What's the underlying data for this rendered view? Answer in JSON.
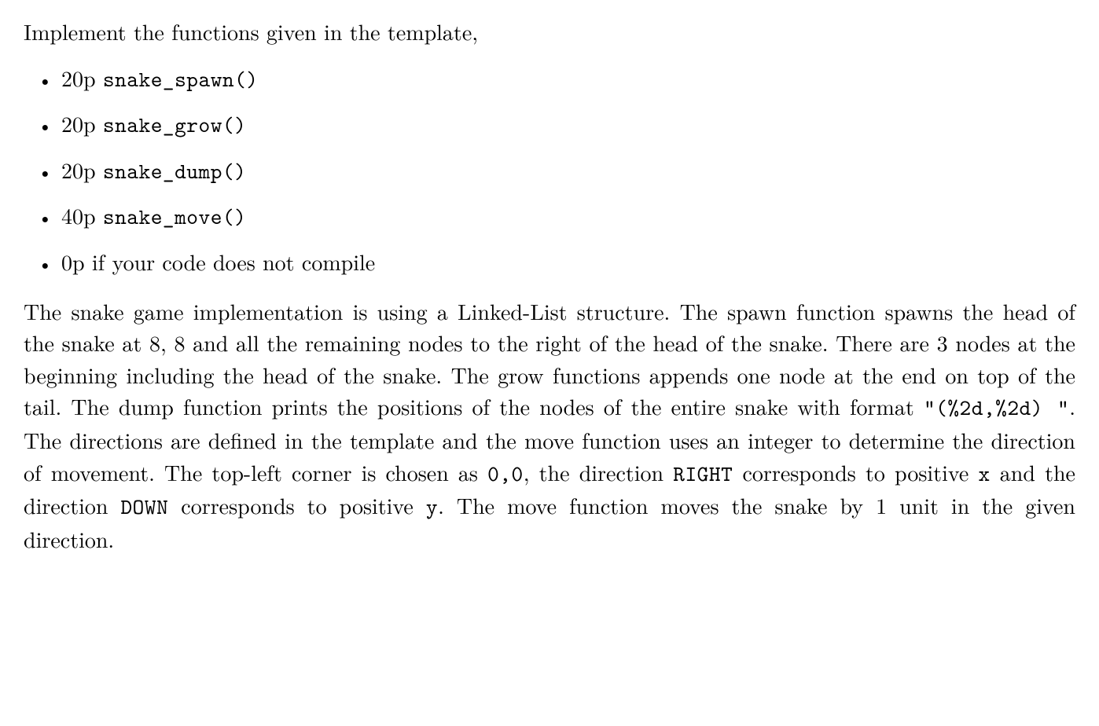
{
  "intro": "Implement the functions given in the template,",
  "items": [
    {
      "points": "20p ",
      "code": "snake_spawn()",
      "suffix": ""
    },
    {
      "points": "20p ",
      "code": "snake_grow()",
      "suffix": ""
    },
    {
      "points": "20p ",
      "code": "snake_dump()",
      "suffix": ""
    },
    {
      "points": "40p ",
      "code": "snake_move()",
      "suffix": ""
    },
    {
      "points": "0p if your code does not compile",
      "code": "",
      "suffix": ""
    }
  ],
  "body": {
    "p1a": "The snake game implementation is using a Linked-List structure. The spawn function spawns the head of the snake at 8, 8 and all the remaining nodes to the right of the head of the snake. There are 3 nodes at the beginning including the head of the snake. The grow functions appends one node at the end on top of the tail. The dump function prints the positions of the nodes of the entire snake with format ",
    "fmt": "\"(%2d,%2d) \"",
    "p1b": ". The directions are defined in the template and the move function uses an integer to determine the direction of movement. The top-left corner is chosen as ",
    "zero": "0,0",
    "p1c": ", the direction ",
    "right": "RIGHT",
    "p1d": " corresponds to positive ",
    "x": "x",
    "p1e": " and the direction ",
    "down": "DOWN",
    "p1f": " corresponds to positive ",
    "y": "y",
    "p1g": ". The move function moves the snake by 1 unit in the given direction."
  }
}
